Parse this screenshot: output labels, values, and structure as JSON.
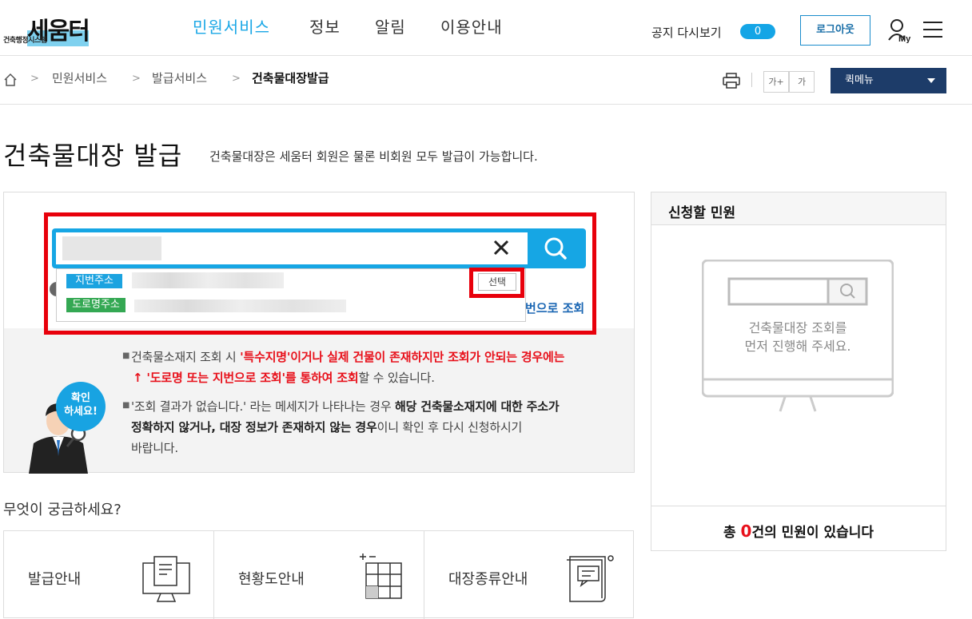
{
  "logo": {
    "main": "세움터",
    "sub": "건축행정시스템"
  },
  "nav": {
    "items": [
      "민원서비스",
      "정보",
      "알림",
      "이용안내"
    ]
  },
  "header": {
    "notice_label": "공지 다시보기",
    "notice_count": "0",
    "logout": "로그아웃",
    "my": "My"
  },
  "breadcrumb": {
    "items": [
      "민원서비스",
      "발급서비스",
      "건축물대장발급"
    ]
  },
  "toolbar": {
    "font_up": "가+",
    "font_down": "가",
    "quick_menu": "퀵메뉴"
  },
  "page": {
    "title": "건축물대장 발급",
    "desc": "건축물대장은 세움터 회원은 물론 비회원 모두 발급이 가능합니다."
  },
  "search": {
    "tag_jibun": "지번주소",
    "tag_road": "도로명주소",
    "select": "선택",
    "road_link": "번으로 조회"
  },
  "info": {
    "l1a": "건축물소재지 조회 시 ",
    "l1b": "'특수지명'이거나 실제 건물이 존재하지만 조회가 안되는 경우에는",
    "l2a": "↑ '도로명 또는 지번으로 조회'",
    "l2b": "를 통하여 조회",
    "l2c": "할 수 있습니다.",
    "l3a": "'조회 결과가 없습니다.' 라는 메세지가 나타나는 경우 ",
    "l3b": "해당 건축물소재지에 대한 주소가",
    "l4a": "정확하지 않거나, 대장 정보가 존재하지 않는 경우",
    "l4b": "이니 확인 후 다시 신청하시기",
    "l5": "바랍니다.",
    "bubble1": "확인",
    "bubble2": "하세요!"
  },
  "faq": {
    "title": "무엇이 궁금하세요?",
    "items": [
      "발급안내",
      "현황도안내",
      "대장종류안내"
    ]
  },
  "apply": {
    "title": "신청할 민원",
    "empty1": "건축물대장 조회를",
    "empty2": "먼저 진행해 주세요.",
    "total_pre": "총 ",
    "total_num": "0",
    "total_post": "건의 민원이 있습니다"
  },
  "colors": {
    "accent": "#16a6e4",
    "navy": "#1d3c69",
    "highlight": "#e8000b",
    "road_tag": "#34a853"
  }
}
